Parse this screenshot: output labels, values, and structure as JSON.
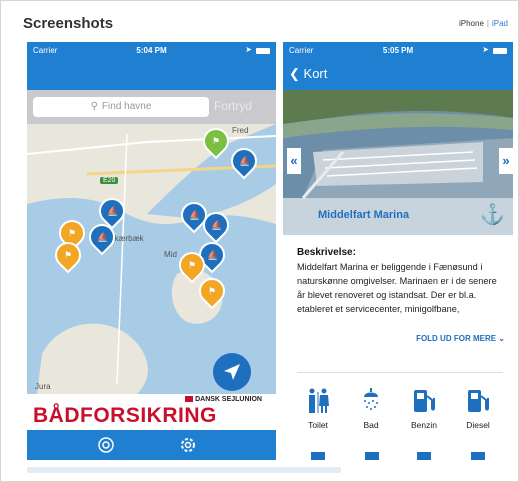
{
  "header": {
    "title": "Screenshots",
    "device_links": [
      "iPhone",
      "iPad"
    ],
    "separator": "|"
  },
  "colors": {
    "accent_blue": "#1f7fd1",
    "pin_blue": "#1f6fbf",
    "pin_orange": "#f2a623",
    "pin_green": "#7ac142",
    "ad_red": "#c8102e"
  },
  "left_phone": {
    "status": {
      "carrier": "Carrier",
      "time": "5:04 PM"
    },
    "search": {
      "placeholder": "Find havne",
      "cancel_label": "Fortryd"
    },
    "map": {
      "labels": [
        "E20",
        "Fred",
        "Skærbæk",
        "Mid",
        "Jura"
      ],
      "icons": [
        "boat-pin-icon",
        "flag-pin-icon",
        "locate-arrow-icon"
      ]
    },
    "ad": {
      "brand": "DANSK SEJLUNION",
      "title": "BÅDFORSIKRING"
    },
    "tabbar": {
      "icons": [
        "lifebuoy-icon",
        "settings-icon"
      ]
    }
  },
  "right_phone": {
    "status": {
      "carrier": "Carrier",
      "time": "5:05 PM"
    },
    "nav": {
      "back_label": "Kort"
    },
    "hero": {
      "name": "Middelfart Marina",
      "prev": "«",
      "next": "»"
    },
    "description": {
      "heading": "Beskrivelse:",
      "body": "Middelfart Marina er beliggende i Fænøsund i naturskønne omgivelser. Marinaen er i de senere år blevet renoveret og istandsat. Der er bl.a. etableret et servicecenter, minigolfbane,"
    },
    "fold_label": "FOLD UD FOR MERE",
    "facilities": [
      {
        "label": "Toilet",
        "icon": "toilet-icon"
      },
      {
        "label": "Bad",
        "icon": "shower-icon"
      },
      {
        "label": "Benzin",
        "icon": "fuel-pump-icon"
      },
      {
        "label": "Diesel",
        "icon": "fuel-pump-icon"
      }
    ]
  }
}
